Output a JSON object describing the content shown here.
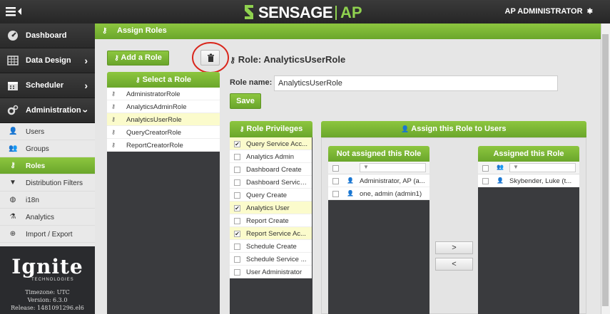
{
  "header": {
    "brand": "SENSAGE",
    "brand_suffix": "AP",
    "user": "AP ADMINISTRATOR"
  },
  "sidebar": {
    "main_items": [
      {
        "label": "Dashboard",
        "icon": "dashboard-icon"
      },
      {
        "label": "Data Design",
        "icon": "table-icon"
      },
      {
        "label": "Scheduler",
        "icon": "calendar-icon"
      },
      {
        "label": "Administration",
        "icon": "gears-icon"
      }
    ],
    "sub_items": [
      {
        "label": "Users",
        "icon": "user-icon"
      },
      {
        "label": "Groups",
        "icon": "group-icon"
      },
      {
        "label": "Roles",
        "icon": "key-icon",
        "active": true
      },
      {
        "label": "Distribution Filters",
        "icon": "filter-icon"
      },
      {
        "label": "i18n",
        "icon": "globe-icon"
      },
      {
        "label": "Analytics",
        "icon": "flask-icon"
      },
      {
        "label": "Import / Export",
        "icon": "import-export-icon"
      }
    ],
    "footer": {
      "brand": "Ignite",
      "brand_sub": "TECHNOLOGIES",
      "timezone": "Timezone: UTC",
      "version": "Version:  6.3.0",
      "release": "Release: 1481091296.el6"
    }
  },
  "page": {
    "title": "Assign Roles",
    "add_role_label": "Add a Role",
    "select_role_label": "Select a Role",
    "roles": [
      "AdministratorRole",
      "AnalyticsAdminRole",
      "AnalyticsUserRole",
      "QueryCreatorRole",
      "ReportCreatorRole"
    ],
    "selected_role_index": 2,
    "role_heading": "Role: AnalyticsUserRole",
    "role_name_label": "Role name:",
    "role_name_value": "AnalyticsUserRole",
    "save_label": "Save",
    "privileges_header": "Role Privileges",
    "privileges": [
      {
        "label": "Query Service Acc...",
        "checked": true
      },
      {
        "label": "Analytics Admin",
        "checked": false
      },
      {
        "label": "Dashboard Create",
        "checked": false
      },
      {
        "label": "Dashboard Service...",
        "checked": false
      },
      {
        "label": "Query Create",
        "checked": false
      },
      {
        "label": "Analytics User",
        "checked": true
      },
      {
        "label": "Report Create",
        "checked": false
      },
      {
        "label": "Report Service Ac...",
        "checked": true
      },
      {
        "label": "Schedule Create",
        "checked": false
      },
      {
        "label": "Schedule Service ...",
        "checked": false
      },
      {
        "label": "User Administrator",
        "checked": false
      }
    ],
    "assign_header": "Assign this Role to Users",
    "not_assigned_header": "Not assigned this Role",
    "not_assigned_users": [
      "Administrator, AP (a...",
      "one, admin (admin1)"
    ],
    "assigned_header": "Assigned this Role",
    "assigned_users": [
      "Skybender, Luke (t..."
    ],
    "move_right": ">",
    "move_left": "<"
  },
  "colors": {
    "accent_green": "#7ab833",
    "selected_row": "#fbfbcc",
    "annotation_circle": "#d9261c"
  }
}
